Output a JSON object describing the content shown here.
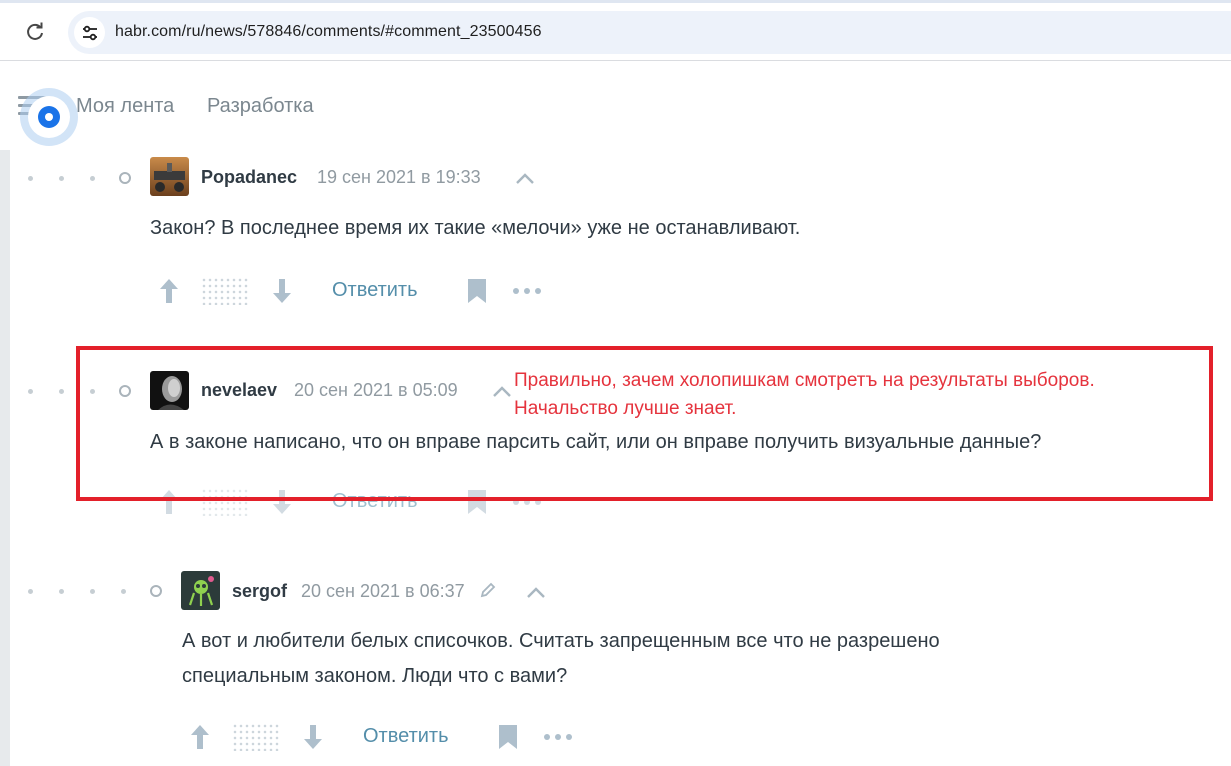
{
  "browser": {
    "url": "habr.com/ru/news/578846/comments/#comment_23500456",
    "reload_icon": "reload-icon",
    "site_info_icon": "tune-icon"
  },
  "header": {
    "nav": [
      "Моя лента",
      "Разработка"
    ],
    "menu_icon": "hamburger-menu-icon"
  },
  "comments": [
    {
      "author": "Popadanec",
      "date": "19 сен 2021 в 19:33",
      "text": "Закон? В последнее время их такие «мелочи» уже не останавливают.",
      "reply_label": "Ответить"
    },
    {
      "author": "nevelaev",
      "date": "20 сен 2021 в 05:09",
      "text": "А в законе написано, что он вправе парсить сайт, или он вправе получить визуальные данные?",
      "reply_label": "Ответить"
    },
    {
      "author": "sergof",
      "date": "20 сен 2021 в 06:37",
      "text_line1": "А вот и любители белых списочков. Считать запрещенным все что не разрешено",
      "text_line2": "специальным законом. Люди что с вами?",
      "reply_label": "Ответить"
    }
  ],
  "annotation": {
    "line1": "Правильно, зачем холопишкам смотретъ на результаты выборов.",
    "line2": "Начальство лучше знает.",
    "color": "#e3202a"
  },
  "colors": {
    "reply_link": "#548eaa",
    "text": "#303b44",
    "muted": "#909aa1"
  }
}
